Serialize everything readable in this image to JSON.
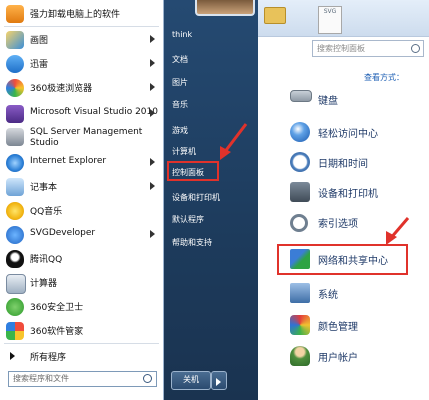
{
  "start_menu": {
    "programs": [
      {
        "label": "强力卸载电脑上的软件",
        "icon": "uninstall-icon",
        "submenu": false
      },
      {
        "label": "画图",
        "icon": "paint-icon",
        "submenu": true
      },
      {
        "label": "迅雷",
        "icon": "thunder-icon",
        "submenu": true
      },
      {
        "label": "360极速浏览器",
        "icon": "360-browser-icon",
        "submenu": true
      },
      {
        "label": "Microsoft Visual Studio 2010",
        "icon": "visual-studio-icon",
        "submenu": true
      },
      {
        "label": "SQL Server Management",
        "label2": "Studio",
        "icon": "sql-server-icon",
        "submenu": false
      },
      {
        "label": "Internet Explorer",
        "icon": "internet-explorer-icon",
        "submenu": true
      },
      {
        "label": "记事本",
        "icon": "notepad-icon",
        "submenu": true
      },
      {
        "label": "QQ音乐",
        "icon": "qq-music-icon",
        "submenu": false
      },
      {
        "label": "SVGDeveloper",
        "icon": "svg-developer-icon",
        "submenu": true
      },
      {
        "label": "腾讯QQ",
        "icon": "qq-icon",
        "submenu": false
      },
      {
        "label": "计算器",
        "icon": "calculator-icon",
        "submenu": false
      },
      {
        "label": "360安全卫士",
        "icon": "360-safe-icon",
        "submenu": false
      },
      {
        "label": "360软件管家",
        "icon": "360-software-icon",
        "submenu": false
      }
    ],
    "all_programs": "所有程序",
    "search_placeholder": "搜索程序和文件",
    "right_items": [
      "think",
      "文档",
      "图片",
      "音乐",
      "游戏",
      "计算机",
      "控制面板",
      "设备和打印机",
      "默认程序",
      "帮助和支持"
    ],
    "shutdown_label": "关机"
  },
  "control_panel": {
    "title_doc": "SVG",
    "search_placeholder": "搜索控制面板",
    "view_by": "查看方式：",
    "items": [
      {
        "label": "键盘",
        "icon": "keyboard-icon"
      },
      {
        "label": "轻松访问中心",
        "icon": "ease-of-access-icon"
      },
      {
        "label": "日期和时间",
        "icon": "clock-icon"
      },
      {
        "label": "设备和打印机",
        "icon": "printer-icon"
      },
      {
        "label": "索引选项",
        "icon": "indexing-icon"
      },
      {
        "label": "网络和共享中心",
        "icon": "network-icon"
      },
      {
        "label": "系统",
        "icon": "system-icon"
      },
      {
        "label": "颜色管理",
        "icon": "color-management-icon"
      },
      {
        "label": "用户帐户",
        "icon": "user-accounts-icon"
      }
    ]
  },
  "colors": {
    "highlight": "#e0322b",
    "start_bg": "#1f3d60"
  }
}
